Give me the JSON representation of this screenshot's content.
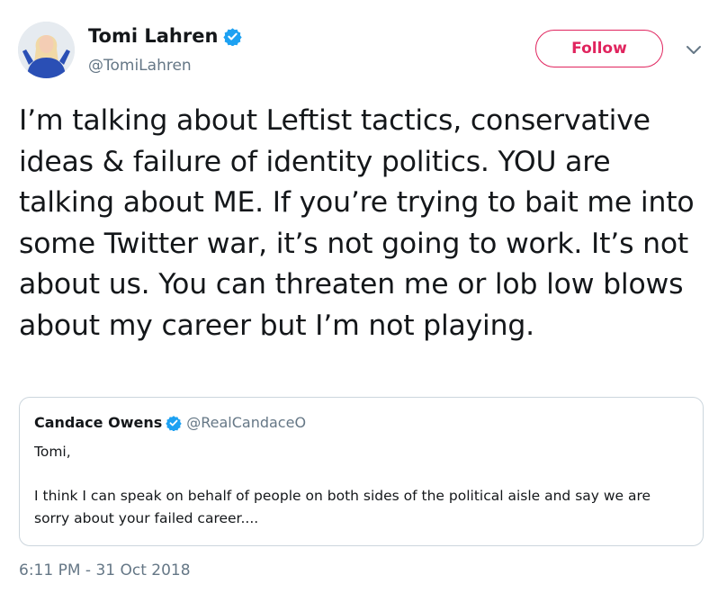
{
  "author": {
    "display_name": "Tomi Lahren",
    "handle": "@TomiLahren",
    "verified": true
  },
  "follow_button": {
    "label": "Follow",
    "color": "#e0245e"
  },
  "tweet": {
    "text": "I’m talking about Leftist tactics, conservative ideas & failure of identity politics. YOU are talking about ME. If you’re trying to bait me into some Twitter war, it’s not going to work. It’s not about us. You can threaten me or lob low blows about my career but I’m not playing.",
    "timestamp": "6:11 PM - 31 Oct 2018"
  },
  "quoted_tweet": {
    "display_name": "Candace Owens",
    "handle": "@RealCandaceO",
    "verified": true,
    "greeting": "Tomi,",
    "body": "I think I can speak on behalf of people on both sides of the political aisle and say we are sorry about your failed career...."
  },
  "colors": {
    "verified_badge": "#1da1f2",
    "secondary_text": "#657786",
    "border": "#ccd6dd"
  },
  "icons": {
    "verified": "verified-badge-icon",
    "menu": "chevron-down-icon"
  }
}
